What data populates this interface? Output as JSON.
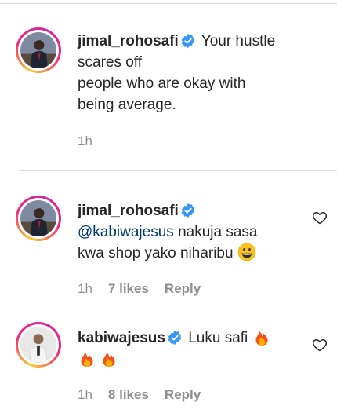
{
  "comments": [
    {
      "username": "jimal_rohosafi",
      "text_lines": [
        "Your hustle",
        "scares off",
        "people who are okay with",
        "being average."
      ],
      "time": "1h"
    },
    {
      "username": "jimal_rohosafi",
      "mention": "@kabiwajesus",
      "text_line1": " nakuja sasa",
      "text_line2": "kwa shop yako niharibu ",
      "emoji": "grinning-face-emoji",
      "time": "1h",
      "likes": "7 likes",
      "reply_label": "Reply"
    },
    {
      "username": "kabiwajesus",
      "text": "Luku safi ",
      "emoji": "fire-emoji",
      "time": "1h",
      "likes": "8 likes",
      "reply_label": "Reply"
    }
  ],
  "colors": {
    "verified": "#3897f0",
    "mention": "#00376b",
    "meta": "#8e8e8e",
    "divider": "#dbdbdb"
  },
  "icons": [
    "verified-badge-icon",
    "heart-icon",
    "fire-emoji",
    "grinning-face-emoji"
  ]
}
